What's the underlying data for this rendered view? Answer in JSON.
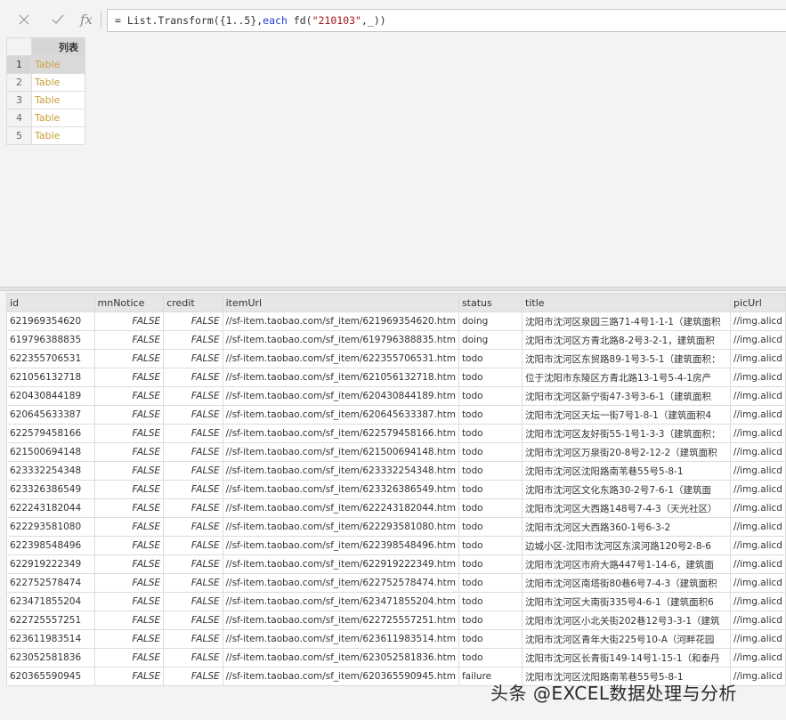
{
  "formula": {
    "prefix": "= List.Transform({1..5},",
    "keyword": "each",
    "call": " fd(",
    "string": "\"210103\"",
    "suffix": ",_))",
    "cancel_icon": "close-icon",
    "confirm_icon": "check-icon",
    "fx_label": "fx"
  },
  "list_preview": {
    "header": "列表",
    "rows": [
      {
        "num": "1",
        "value": "Table"
      },
      {
        "num": "2",
        "value": "Table"
      },
      {
        "num": "3",
        "value": "Table"
      },
      {
        "num": "4",
        "value": "Table"
      },
      {
        "num": "5",
        "value": "Table"
      }
    ],
    "selected_row": 1,
    "link_color": "#c9a13b"
  },
  "detail": {
    "columns": [
      "id",
      "mnNotice",
      "credit",
      "itemUrl",
      "status",
      "title",
      "picUrl"
    ],
    "rows": [
      [
        "621969354620",
        "FALSE",
        "FALSE",
        "//sf-item.taobao.com/sf_item/621969354620.htm",
        "doing",
        "沈阳市沈河区泉园三路71-4号1-1-1（建筑面积",
        "//img.alicd"
      ],
      [
        "619796388835",
        "FALSE",
        "FALSE",
        "//sf-item.taobao.com/sf_item/619796388835.htm",
        "doing",
        "沈阳市沈河区方青北路8-2号3-2-1，建筑面积",
        "//img.alicd"
      ],
      [
        "622355706531",
        "FALSE",
        "FALSE",
        "//sf-item.taobao.com/sf_item/622355706531.htm",
        "todo",
        "沈阳市沈河区东贸路89-1号3-5-1（建筑面积：",
        "//img.alicd"
      ],
      [
        "621056132718",
        "FALSE",
        "FALSE",
        "//sf-item.taobao.com/sf_item/621056132718.htm",
        "todo",
        "位于沈阳市东陵区方青北路13-1号5-4-1房产",
        "//img.alicd"
      ],
      [
        "620430844189",
        "FALSE",
        "FALSE",
        "//sf-item.taobao.com/sf_item/620430844189.htm",
        "todo",
        "沈阳市沈河区新宁街47-3号3-6-1（建筑面积",
        "//img.alicd"
      ],
      [
        "620645633387",
        "FALSE",
        "FALSE",
        "//sf-item.taobao.com/sf_item/620645633387.htm",
        "todo",
        "沈阳市沈河区天坛一街7号1-8-1（建筑面积4",
        "//img.alicd"
      ],
      [
        "622579458166",
        "FALSE",
        "FALSE",
        "//sf-item.taobao.com/sf_item/622579458166.htm",
        "todo",
        "沈阳市沈河区友好街55-1号1-3-3（建筑面积：",
        "//img.alicd"
      ],
      [
        "621500694148",
        "FALSE",
        "FALSE",
        "//sf-item.taobao.com/sf_item/621500694148.htm",
        "todo",
        "沈阳市沈河区万泉街20-8号2-12-2（建筑面积",
        "//img.alicd"
      ],
      [
        "623332254348",
        "FALSE",
        "FALSE",
        "//sf-item.taobao.com/sf_item/623332254348.htm",
        "todo",
        "沈阳市沈河区沈阳路南苇巷55号5-8-1",
        "//img.alicd"
      ],
      [
        "623326386549",
        "FALSE",
        "FALSE",
        "//sf-item.taobao.com/sf_item/623326386549.htm",
        "todo",
        "沈阳市沈河区文化东路30-2号7-6-1（建筑面",
        "//img.alicd"
      ],
      [
        "622243182044",
        "FALSE",
        "FALSE",
        "//sf-item.taobao.com/sf_item/622243182044.htm",
        "todo",
        "沈阳市沈河区大西路148号7-4-3（天光社区）",
        "//img.alicd"
      ],
      [
        "622293581080",
        "FALSE",
        "FALSE",
        "//sf-item.taobao.com/sf_item/622293581080.htm",
        "todo",
        "沈阳市沈河区大西路360-1号6-3-2",
        "//img.alicd"
      ],
      [
        "622398548496",
        "FALSE",
        "FALSE",
        "//sf-item.taobao.com/sf_item/622398548496.htm",
        "todo",
        "边城小区-沈阳市沈河区东滨河路120号2-8-6",
        "//img.alicd"
      ],
      [
        "622919222349",
        "FALSE",
        "FALSE",
        "//sf-item.taobao.com/sf_item/622919222349.htm",
        "todo",
        "沈阳市沈河区市府大路447号1-14-6，建筑面",
        "//img.alicd"
      ],
      [
        "622752578474",
        "FALSE",
        "FALSE",
        "//sf-item.taobao.com/sf_item/622752578474.htm",
        "todo",
        "沈阳市沈河区南塔街80巷6号7-4-3（建筑面积",
        "//img.alicd"
      ],
      [
        "623471855204",
        "FALSE",
        "FALSE",
        "//sf-item.taobao.com/sf_item/623471855204.htm",
        "todo",
        "沈阳市沈河区大南街335号4-6-1（建筑面积6",
        "//img.alicd"
      ],
      [
        "622725557251",
        "FALSE",
        "FALSE",
        "//sf-item.taobao.com/sf_item/622725557251.htm",
        "todo",
        "沈阳市沈河区小北关街202巷12号3-3-1（建筑",
        "//img.alicd"
      ],
      [
        "623611983514",
        "FALSE",
        "FALSE",
        "//sf-item.taobao.com/sf_item/623611983514.htm",
        "todo",
        "沈阳市沈河区青年大街225号10-A（河畔花园",
        "//img.alicd"
      ],
      [
        "623052581836",
        "FALSE",
        "FALSE",
        "//sf-item.taobao.com/sf_item/623052581836.htm",
        "todo",
        "沈阳市沈河区长青街149-14号1-15-1（和泰丹",
        "//img.alicd"
      ],
      [
        "620365590945",
        "FALSE",
        "FALSE",
        "//sf-item.taobao.com/sf_item/620365590945.htm",
        "failure",
        "沈阳市沈河区沈阳路南苇巷55号5-8-1",
        "//img.alicd"
      ]
    ]
  },
  "watermark": "头条 @EXCEL数据处理与分析"
}
